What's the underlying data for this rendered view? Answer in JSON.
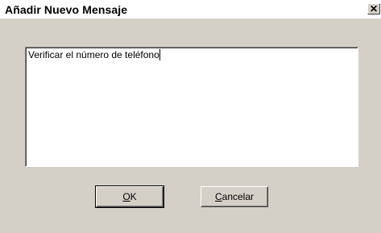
{
  "window": {
    "title": "Añadir Nuevo Mensaje",
    "close_label": "✕"
  },
  "message": {
    "value": "Verificar el número de teléfono"
  },
  "buttons": {
    "ok": {
      "mnemonic": "O",
      "rest": "K"
    },
    "cancel": {
      "mnemonic": "C",
      "rest": "ancelar"
    }
  }
}
